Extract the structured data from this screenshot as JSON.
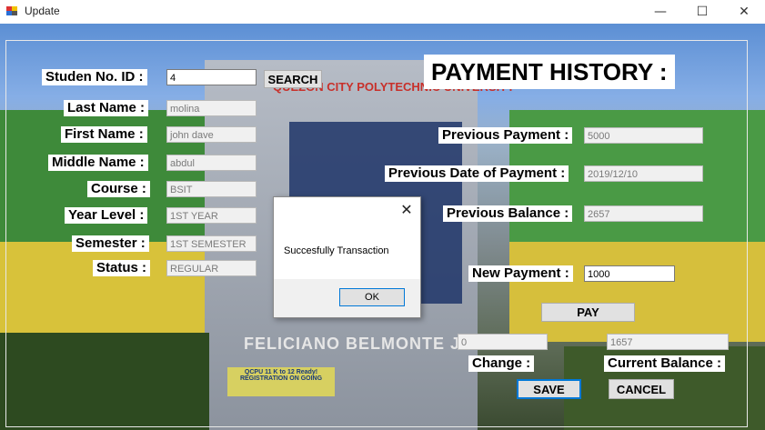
{
  "window": {
    "title": "Update",
    "minimize_glyph": "—",
    "maximize_glyph": "☐",
    "close_glyph": "✕"
  },
  "background": {
    "sign_top": "QUEZON CITY POLYTECHNIC UNIVERSITY",
    "sign_bottom": "FELICIANO BELMONTE JR.",
    "banner": "QCPU 11 K to 12 Ready! REGISTRATION ON GOING"
  },
  "form": {
    "student_no_label": "Studen No. ID :",
    "student_no_value": "4",
    "search_label": "SEARCH",
    "last_name_label": "Last Name :",
    "last_name_value": "molina",
    "first_name_label": "First Name :",
    "first_name_value": "john dave",
    "middle_name_label": "Middle Name :",
    "middle_name_value": "abdul",
    "course_label": "Course :",
    "course_value": "BSIT",
    "year_level_label": "Year Level :",
    "year_level_value": "1ST YEAR",
    "semester_label": "Semester :",
    "semester_value": "1ST SEMESTER",
    "status_label": "Status :",
    "status_value": "REGULAR"
  },
  "payment": {
    "heading": "PAYMENT HISTORY :",
    "previous_payment_label": "Previous Payment :",
    "previous_payment_value": "5000",
    "previous_date_label": "Previous Date of Payment :",
    "previous_date_value": "2019/12/10",
    "previous_balance_label": "Previous Balance :",
    "previous_balance_value": "2657",
    "new_payment_label": "New Payment :",
    "new_payment_value": "1000",
    "pay_label": "PAY",
    "change_value": "0",
    "change_label": "Change :",
    "current_balance_value": "1657",
    "current_balance_label": "Current Balance :",
    "save_label": "SAVE",
    "cancel_label": "CANCEL"
  },
  "dialog": {
    "message": "Succesfully Transaction",
    "ok_label": "OK",
    "close_glyph": "✕"
  }
}
